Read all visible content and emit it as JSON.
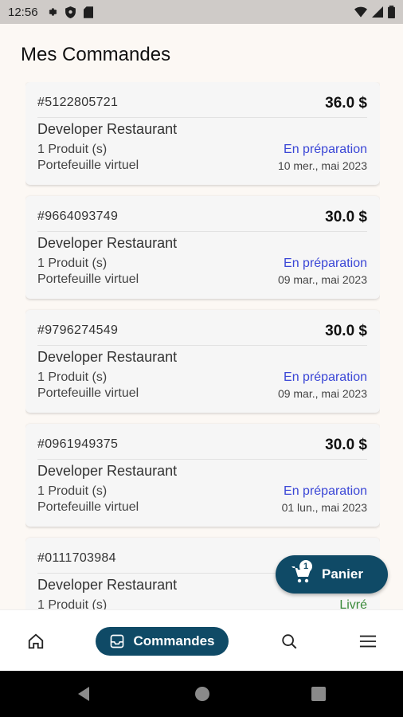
{
  "status_bar": {
    "time": "12:56"
  },
  "page": {
    "title": "Mes Commandes"
  },
  "orders": [
    {
      "id": "#5122805721",
      "amount": "36.0 $",
      "restaurant": "Developer Restaurant",
      "products": "1 Produit (s)",
      "payment": "Portefeuille virtuel",
      "status": "En préparation",
      "date": "10 mer., mai 2023"
    },
    {
      "id": "#9664093749",
      "amount": "30.0 $",
      "restaurant": "Developer Restaurant",
      "products": "1 Produit (s)",
      "payment": "Portefeuille virtuel",
      "status": "En préparation",
      "date": "09 mar., mai 2023"
    },
    {
      "id": "#9796274549",
      "amount": "30.0 $",
      "restaurant": "Developer Restaurant",
      "products": "1 Produit (s)",
      "payment": "Portefeuille virtuel",
      "status": "En préparation",
      "date": "09 mar., mai 2023"
    },
    {
      "id": "#0961949375",
      "amount": "30.0 $",
      "restaurant": "Developer Restaurant",
      "products": "1 Produit (s)",
      "payment": "Portefeuille virtuel",
      "status": "En préparation",
      "date": "01 lun., mai 2023"
    },
    {
      "id": "#0111703984",
      "amount": "",
      "restaurant": "Developer Restaurant",
      "products": "1 Produit (s)",
      "payment": "",
      "status": "Livré",
      "date": ""
    }
  ],
  "cart_fab": {
    "label": "Panier",
    "badge": "1"
  },
  "bottom_nav": {
    "active_label": "Commandes"
  },
  "colors": {
    "primary": "#0f4a66",
    "status_preparing": "#3a46d6",
    "status_delivered": "#3a8a3a",
    "background": "#fcf8f4"
  }
}
